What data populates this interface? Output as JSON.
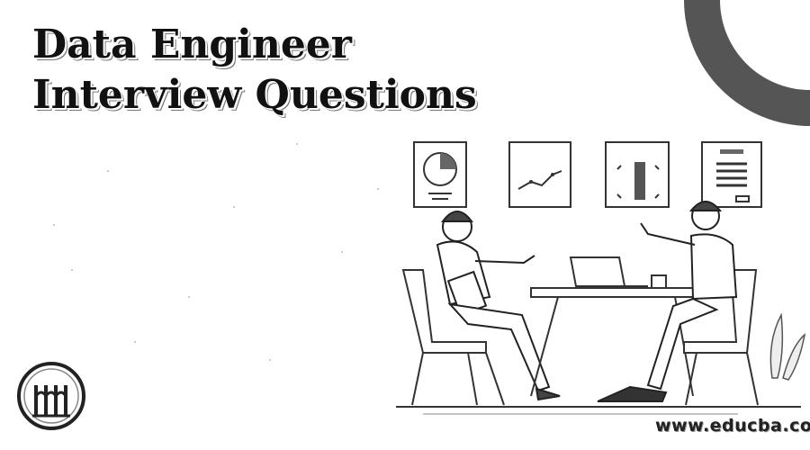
{
  "title": {
    "line1": "Data Engineer",
    "line2": "Interview Questions"
  },
  "watermark": "www.educba.com",
  "icons": {
    "logo": "educba-logo-icon",
    "pie_chart": "pie-chart-card-icon",
    "line_chart": "line-chart-card-icon",
    "bar_chart": "bar-chart-card-icon",
    "document": "document-card-icon"
  },
  "colors": {
    "ink": "#111111",
    "shadow": "#777777",
    "paper": "#ffffff"
  }
}
